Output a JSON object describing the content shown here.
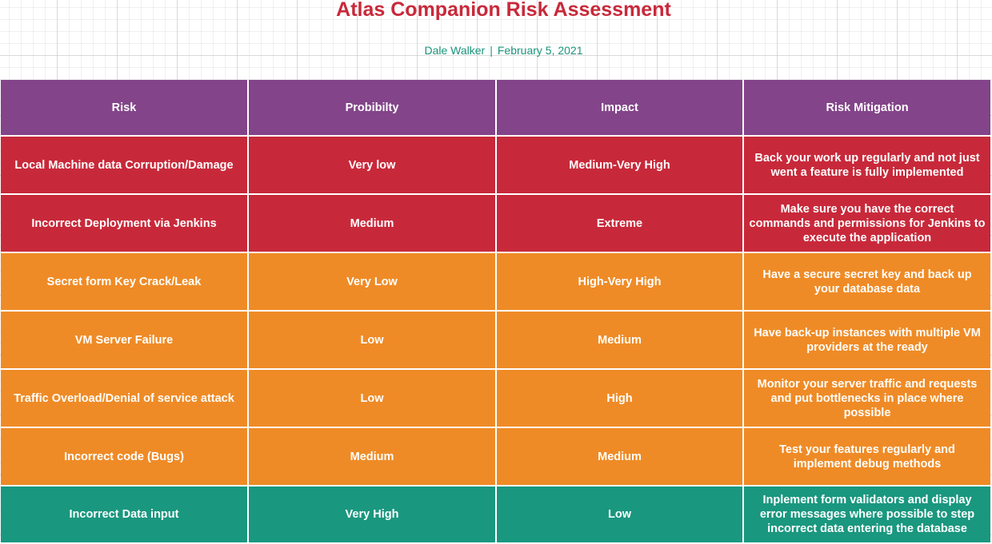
{
  "title": "Atlas Companion Risk Assessment",
  "author": "Dale Walker",
  "separator": "|",
  "date": "February 5, 2021",
  "colors": {
    "title": "#c8293a",
    "subtitle": "#19957c",
    "header": "#834489",
    "red": "#c8293a",
    "orange": "#ef8b26",
    "green": "#1a977f"
  },
  "columns": [
    "Risk",
    "Probibilty",
    "Impact",
    "Risk Mitigation"
  ],
  "rows": [
    {
      "level": "red",
      "risk": "Local Machine data Corruption/Damage",
      "probability": "Very low",
      "impact": "Medium-Very High",
      "mitigation": "Back your work up regularly and not just went a feature is fully implemented"
    },
    {
      "level": "red",
      "risk": "Incorrect Deployment via Jenkins",
      "probability": "Medium",
      "impact": "Extreme",
      "mitigation": "Make sure you have the correct commands and permissions for Jenkins to execute the application"
    },
    {
      "level": "orange",
      "risk": "Secret form Key Crack/Leak",
      "probability": "Very Low",
      "impact": "High-Very High",
      "mitigation": "Have a secure secret key and back up your database data"
    },
    {
      "level": "orange",
      "risk": "VM Server Failure",
      "probability": "Low",
      "impact": "Medium",
      "mitigation": "Have back-up instances with multiple VM providers at the ready"
    },
    {
      "level": "orange",
      "risk": "Traffic Overload/Denial of service attack",
      "probability": "Low",
      "impact": "High",
      "mitigation": "Monitor your server traffic and requests and put bottlenecks in place where possible"
    },
    {
      "level": "orange",
      "risk": "Incorrect code (Bugs)",
      "probability": "Medium",
      "impact": "Medium",
      "mitigation": "Test your features regularly and implement debug methods"
    },
    {
      "level": "green",
      "risk": "Incorrect Data input",
      "probability": "Very High",
      "impact": "Low",
      "mitigation": "Inplement form validators and display error messages where possible to step incorrect data entering the database"
    }
  ]
}
